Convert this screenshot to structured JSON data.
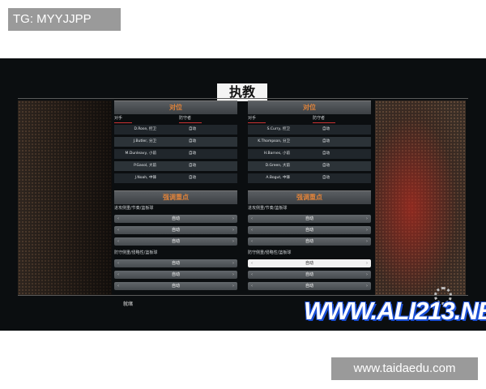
{
  "overlay": {
    "tg_label": "TG: MYYJJPP",
    "site_label": "www.taidaedu.com"
  },
  "game": {
    "title": "执教",
    "footer": "就绪",
    "watermark": "WWW.ALI213.NET"
  },
  "left": {
    "matchup_header": "对位",
    "col_offense": "对手",
    "col_defense": "防守者",
    "players": [
      {
        "name": "D.Rose, 控卫",
        "value": "自动"
      },
      {
        "name": "J.Butler, 分卫",
        "value": "自动"
      },
      {
        "name": "M.Dunleavy, 小前",
        "value": "自动"
      },
      {
        "name": "P.Gasol, 大前",
        "value": "自动"
      },
      {
        "name": "J.Noah, 中锋",
        "value": "自动"
      }
    ],
    "focus_header": "强调重点",
    "offense_label": "进攻侧重/节奏/篮板球",
    "offense_buttons": [
      "自动",
      "自动",
      "自动"
    ],
    "defense_label": "防守侧重/侵略性/篮板球",
    "defense_buttons": [
      "自动",
      "自动",
      "自动"
    ]
  },
  "right": {
    "matchup_header": "对位",
    "col_offense": "对手",
    "col_defense": "防守者",
    "players": [
      {
        "name": "S.Curry, 控卫",
        "value": "自动"
      },
      {
        "name": "K.Thompson, 分卫",
        "value": "自动"
      },
      {
        "name": "H.Barnes, 小前",
        "value": "自动"
      },
      {
        "name": "D.Green, 大前",
        "value": "自动"
      },
      {
        "name": "A.Bogut, 中锋",
        "value": "自动"
      }
    ],
    "focus_header": "强调重点",
    "offense_label": "进攻侧重/节奏/篮板球",
    "offense_buttons": [
      "自动",
      "自动",
      "自动"
    ],
    "defense_label": "防守侧重/侵略性/篮板球",
    "defense_buttons": [
      "自动",
      "自动",
      "自动"
    ]
  },
  "icons": {
    "arrow_left": "‹",
    "arrow_right": "›"
  }
}
